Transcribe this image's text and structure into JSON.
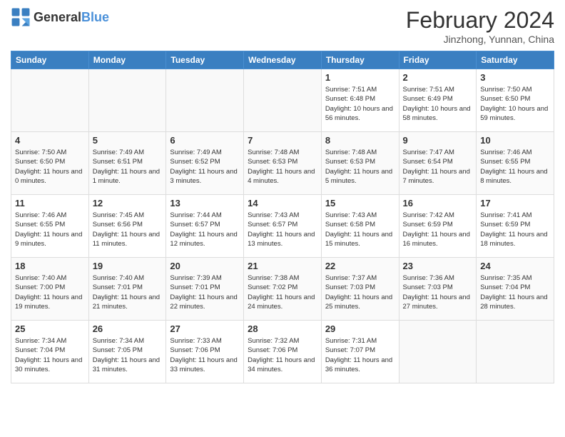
{
  "header": {
    "logo_general": "General",
    "logo_blue": "Blue",
    "title": "February 2024",
    "location": "Jinzhong, Yunnan, China"
  },
  "weekdays": [
    "Sunday",
    "Monday",
    "Tuesday",
    "Wednesday",
    "Thursday",
    "Friday",
    "Saturday"
  ],
  "weeks": [
    [
      {
        "day": "",
        "info": ""
      },
      {
        "day": "",
        "info": ""
      },
      {
        "day": "",
        "info": ""
      },
      {
        "day": "",
        "info": ""
      },
      {
        "day": "1",
        "info": "Sunrise: 7:51 AM\nSunset: 6:48 PM\nDaylight: 10 hours and 56 minutes."
      },
      {
        "day": "2",
        "info": "Sunrise: 7:51 AM\nSunset: 6:49 PM\nDaylight: 10 hours and 58 minutes."
      },
      {
        "day": "3",
        "info": "Sunrise: 7:50 AM\nSunset: 6:50 PM\nDaylight: 10 hours and 59 minutes."
      }
    ],
    [
      {
        "day": "4",
        "info": "Sunrise: 7:50 AM\nSunset: 6:50 PM\nDaylight: 11 hours and 0 minutes."
      },
      {
        "day": "5",
        "info": "Sunrise: 7:49 AM\nSunset: 6:51 PM\nDaylight: 11 hours and 1 minute."
      },
      {
        "day": "6",
        "info": "Sunrise: 7:49 AM\nSunset: 6:52 PM\nDaylight: 11 hours and 3 minutes."
      },
      {
        "day": "7",
        "info": "Sunrise: 7:48 AM\nSunset: 6:53 PM\nDaylight: 11 hours and 4 minutes."
      },
      {
        "day": "8",
        "info": "Sunrise: 7:48 AM\nSunset: 6:53 PM\nDaylight: 11 hours and 5 minutes."
      },
      {
        "day": "9",
        "info": "Sunrise: 7:47 AM\nSunset: 6:54 PM\nDaylight: 11 hours and 7 minutes."
      },
      {
        "day": "10",
        "info": "Sunrise: 7:46 AM\nSunset: 6:55 PM\nDaylight: 11 hours and 8 minutes."
      }
    ],
    [
      {
        "day": "11",
        "info": "Sunrise: 7:46 AM\nSunset: 6:55 PM\nDaylight: 11 hours and 9 minutes."
      },
      {
        "day": "12",
        "info": "Sunrise: 7:45 AM\nSunset: 6:56 PM\nDaylight: 11 hours and 11 minutes."
      },
      {
        "day": "13",
        "info": "Sunrise: 7:44 AM\nSunset: 6:57 PM\nDaylight: 11 hours and 12 minutes."
      },
      {
        "day": "14",
        "info": "Sunrise: 7:43 AM\nSunset: 6:57 PM\nDaylight: 11 hours and 13 minutes."
      },
      {
        "day": "15",
        "info": "Sunrise: 7:43 AM\nSunset: 6:58 PM\nDaylight: 11 hours and 15 minutes."
      },
      {
        "day": "16",
        "info": "Sunrise: 7:42 AM\nSunset: 6:59 PM\nDaylight: 11 hours and 16 minutes."
      },
      {
        "day": "17",
        "info": "Sunrise: 7:41 AM\nSunset: 6:59 PM\nDaylight: 11 hours and 18 minutes."
      }
    ],
    [
      {
        "day": "18",
        "info": "Sunrise: 7:40 AM\nSunset: 7:00 PM\nDaylight: 11 hours and 19 minutes."
      },
      {
        "day": "19",
        "info": "Sunrise: 7:40 AM\nSunset: 7:01 PM\nDaylight: 11 hours and 21 minutes."
      },
      {
        "day": "20",
        "info": "Sunrise: 7:39 AM\nSunset: 7:01 PM\nDaylight: 11 hours and 22 minutes."
      },
      {
        "day": "21",
        "info": "Sunrise: 7:38 AM\nSunset: 7:02 PM\nDaylight: 11 hours and 24 minutes."
      },
      {
        "day": "22",
        "info": "Sunrise: 7:37 AM\nSunset: 7:03 PM\nDaylight: 11 hours and 25 minutes."
      },
      {
        "day": "23",
        "info": "Sunrise: 7:36 AM\nSunset: 7:03 PM\nDaylight: 11 hours and 27 minutes."
      },
      {
        "day": "24",
        "info": "Sunrise: 7:35 AM\nSunset: 7:04 PM\nDaylight: 11 hours and 28 minutes."
      }
    ],
    [
      {
        "day": "25",
        "info": "Sunrise: 7:34 AM\nSunset: 7:04 PM\nDaylight: 11 hours and 30 minutes."
      },
      {
        "day": "26",
        "info": "Sunrise: 7:34 AM\nSunset: 7:05 PM\nDaylight: 11 hours and 31 minutes."
      },
      {
        "day": "27",
        "info": "Sunrise: 7:33 AM\nSunset: 7:06 PM\nDaylight: 11 hours and 33 minutes."
      },
      {
        "day": "28",
        "info": "Sunrise: 7:32 AM\nSunset: 7:06 PM\nDaylight: 11 hours and 34 minutes."
      },
      {
        "day": "29",
        "info": "Sunrise: 7:31 AM\nSunset: 7:07 PM\nDaylight: 11 hours and 36 minutes."
      },
      {
        "day": "",
        "info": ""
      },
      {
        "day": "",
        "info": ""
      }
    ]
  ]
}
